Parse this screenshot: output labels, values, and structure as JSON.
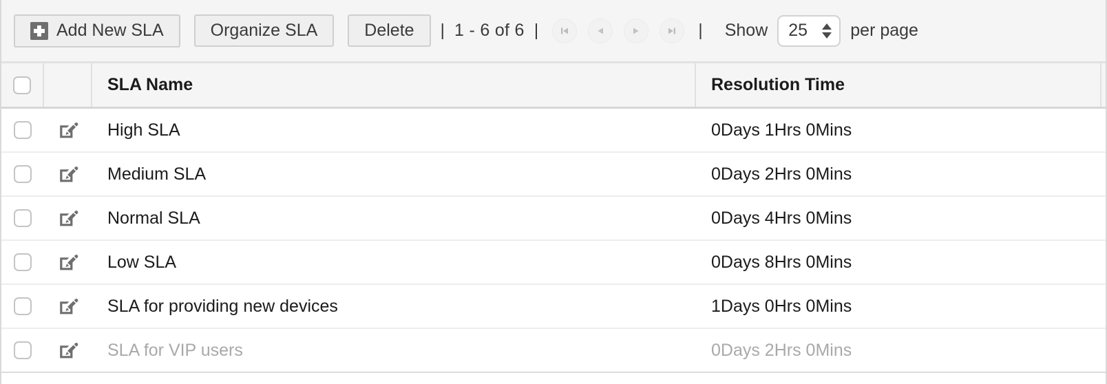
{
  "toolbar": {
    "add_button": {
      "label": "Add New SLA",
      "icon": "plus-square-icon"
    },
    "organize_button": {
      "label": "Organize SLA"
    },
    "delete_button": {
      "label": "Delete"
    },
    "separator": "|",
    "record_range": "1 - 6 of 6",
    "pagination": [
      {
        "name": "first-page-button",
        "glyph": "first",
        "disabled": true
      },
      {
        "name": "previous-page-button",
        "glyph": "prev",
        "disabled": true
      },
      {
        "name": "next-page-button",
        "glyph": "next",
        "disabled": true
      },
      {
        "name": "last-page-button",
        "glyph": "last",
        "disabled": true
      }
    ],
    "show_label": "Show",
    "page_size_value": "25",
    "per_page_label": "per page"
  },
  "table": {
    "columns": [
      {
        "key": "select",
        "label": ""
      },
      {
        "key": "edit",
        "label": ""
      },
      {
        "key": "name",
        "label": "SLA Name"
      },
      {
        "key": "time",
        "label": "Resolution Time"
      }
    ],
    "rows": [
      {
        "name": "High SLA",
        "time": "0Days 1Hrs 0Mins",
        "inactive": false
      },
      {
        "name": "Medium SLA",
        "time": "0Days 2Hrs 0Mins",
        "inactive": false
      },
      {
        "name": "Normal SLA",
        "time": "0Days 4Hrs 0Mins",
        "inactive": false
      },
      {
        "name": "Low SLA",
        "time": "0Days 8Hrs 0Mins",
        "inactive": false
      },
      {
        "name": "SLA for providing new devices",
        "time": "1Days 0Hrs 0Mins",
        "inactive": false
      },
      {
        "name": "SLA for VIP users",
        "time": "0Days 2Hrs 0Mins",
        "inactive": true
      }
    ]
  },
  "colors": {
    "toolbar_bg": "#f5f5f5",
    "header_bg": "#f5f5f5",
    "row_bg": "#ffffff",
    "text": "#1b1b1b",
    "muted_text": "#a9a9a9",
    "border": "#e0e0e0",
    "icon_gray": "#6e6e6e"
  }
}
